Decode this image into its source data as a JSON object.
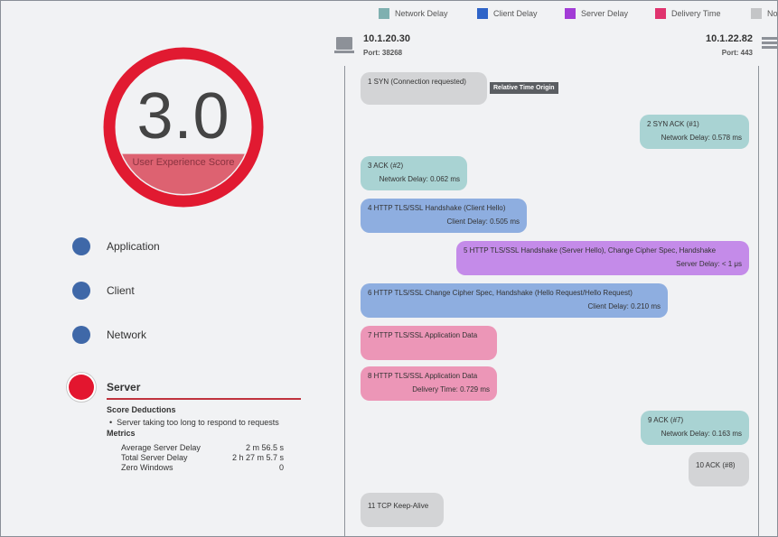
{
  "legend": [
    {
      "label": "Network Delay",
      "color": "#7fb0b0"
    },
    {
      "label": "Client Delay",
      "color": "#2f64c8"
    },
    {
      "label": "Server Delay",
      "color": "#a23cd6"
    },
    {
      "label": "Delivery Time",
      "color": "#e0336e"
    },
    {
      "label": "No",
      "color": "#c4c5c7"
    }
  ],
  "score": {
    "value": "3.0",
    "label": "User Experience Score",
    "fill_fraction": 0.3
  },
  "categories": {
    "application": "Application",
    "client": "Client",
    "network": "Network",
    "server": "Server"
  },
  "server_details": {
    "deductions_heading": "Score Deductions",
    "deduction": "Server taking too long to respond to requests",
    "metrics_heading": "Metrics",
    "metrics": [
      {
        "name": "Average Server Delay",
        "value": "2 m 56.5 s"
      },
      {
        "name": "Total Server Delay",
        "value": "2 h 27 m 5.7 s"
      },
      {
        "name": "Zero Windows",
        "value": "0"
      }
    ]
  },
  "endpoints": {
    "left": {
      "ip": "10.1.20.30",
      "port": "Port: 38268"
    },
    "right": {
      "ip": "10.1.22.82",
      "port": "Port: 443"
    }
  },
  "origin_tag": "Relative Time Origin",
  "messages": [
    {
      "title": "1  SYN (Connection requested)",
      "detail": ""
    },
    {
      "title": "2  SYN ACK (#1)",
      "detail": "Network Delay:  0.578 ms"
    },
    {
      "title": "3  ACK (#2)",
      "detail": "Network Delay:  0.062 ms"
    },
    {
      "title": "4  HTTP TLS/SSL Handshake (Client Hello)",
      "detail": "Client Delay:  0.505 ms"
    },
    {
      "title": "5  HTTP TLS/SSL Handshake (Server Hello), Change Cipher Spec, Handshake",
      "detail": "Server Delay:  < 1 μs"
    },
    {
      "title": "6  HTTP TLS/SSL Change Cipher Spec, Handshake (Hello Request/Hello Request)",
      "detail": "Client Delay:  0.210 ms"
    },
    {
      "title": "7  HTTP TLS/SSL Application Data",
      "detail": ""
    },
    {
      "title": "8  HTTP TLS/SSL Application Data",
      "detail": "Delivery Time:  0.729 ms"
    },
    {
      "title": "9  ACK (#7)",
      "detail": "Network Delay:  0.163 ms"
    },
    {
      "title": "10  ACK (#8)",
      "detail": ""
    },
    {
      "title": "11  TCP Keep-Alive",
      "detail": ""
    }
  ]
}
